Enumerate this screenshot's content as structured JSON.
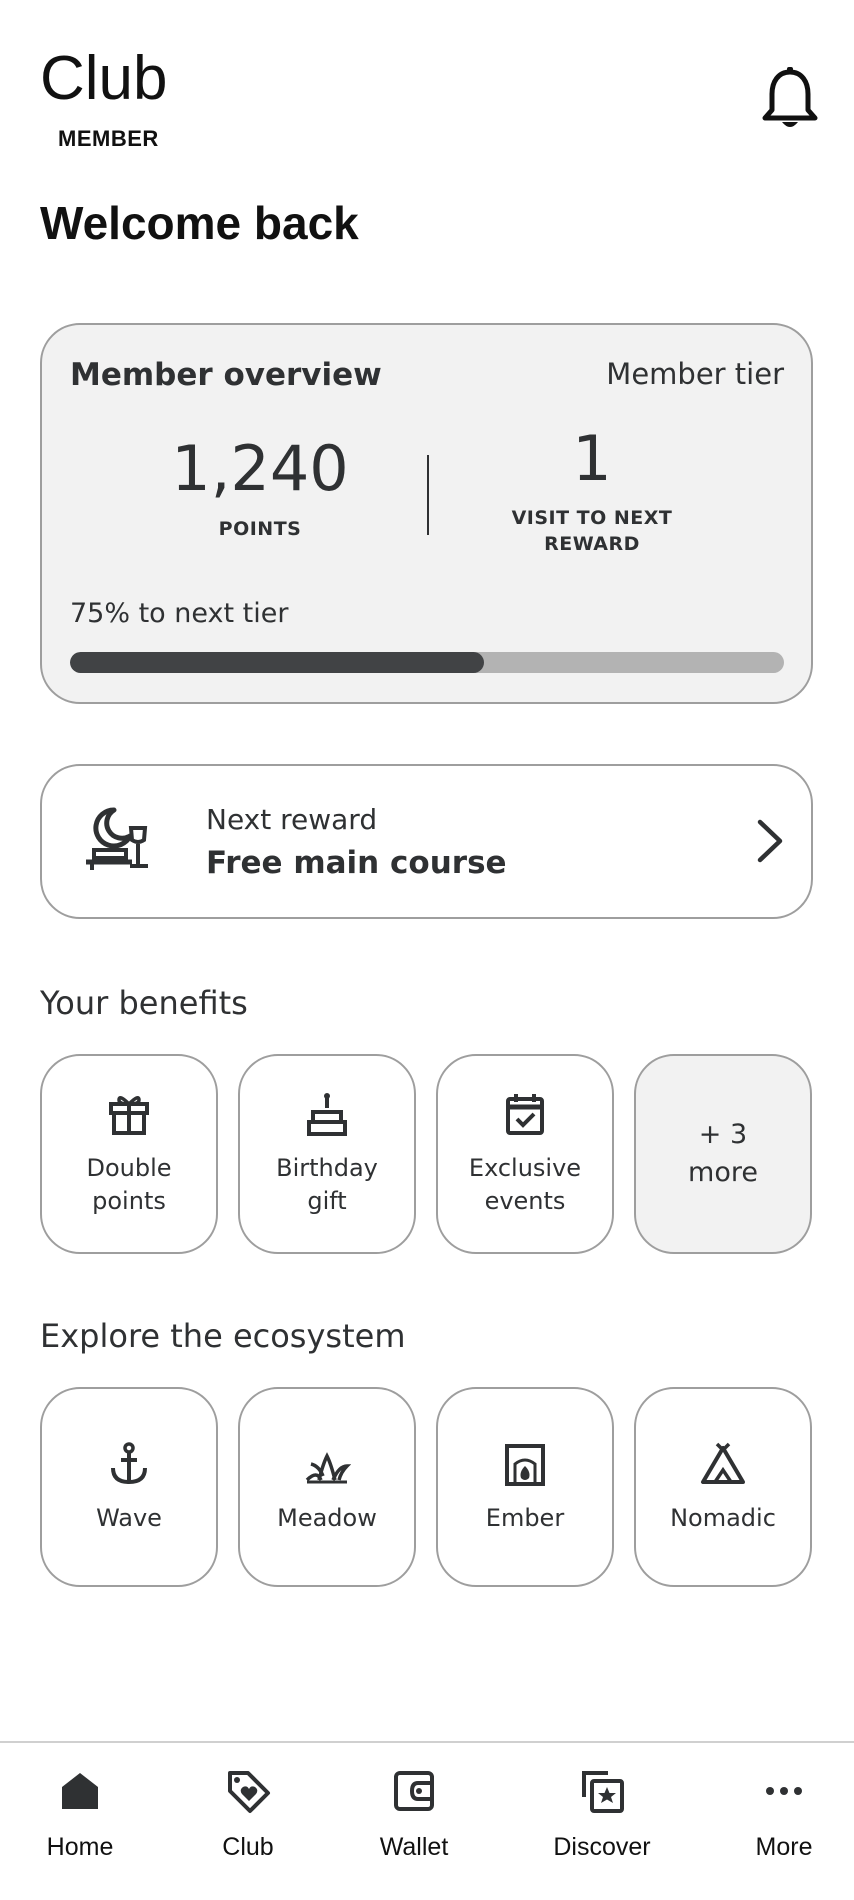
{
  "header": {
    "brand_title": "Club",
    "brand_subtitle": "MEMBER",
    "notification_icon": "bell-icon",
    "greeting": "Welcome back"
  },
  "overview": {
    "title": "Member overview",
    "tier_label": "Member tier",
    "points_value": "1,240",
    "points_label": "POINTS",
    "visits_value": "1",
    "visits_label": "VISIT TO NEXT REWARD",
    "progress_text": "75% to next tier",
    "progress_bar_fraction": 0.58
  },
  "next_reward": {
    "icon": "dinner-icon",
    "label": "Next reward",
    "value": "Free main course",
    "chevron_icon": "chevron-right-icon"
  },
  "benefits": {
    "title": "Your benefits",
    "items": [
      {
        "icon": "gift-icon",
        "label": "Double points"
      },
      {
        "icon": "cake-icon",
        "label": "Birthday gift"
      },
      {
        "icon": "calendar-check-icon",
        "label": "Exclusive events"
      },
      {
        "icon": "",
        "label": "+ 3 more"
      }
    ]
  },
  "ecosystem": {
    "title": "Explore the ecosystem",
    "items": [
      {
        "icon": "anchor-icon",
        "label": "Wave"
      },
      {
        "icon": "grass-icon",
        "label": "Meadow"
      },
      {
        "icon": "fireplace-icon",
        "label": "Ember"
      },
      {
        "icon": "tent-icon",
        "label": "Nomadic"
      }
    ]
  },
  "nav": {
    "items": [
      {
        "icon": "home-icon",
        "label": "Home"
      },
      {
        "icon": "tag-heart-icon",
        "label": "Club"
      },
      {
        "icon": "wallet-icon",
        "label": "Wallet"
      },
      {
        "icon": "discover-icon",
        "label": "Discover"
      },
      {
        "icon": "more-dots-icon",
        "label": "More"
      }
    ]
  },
  "colors": {
    "text": "#2f3133",
    "card_bg": "#f2f2f2",
    "border": "#9e9e9e",
    "progress_fill": "#414345",
    "progress_track": "#b3b3b3"
  }
}
